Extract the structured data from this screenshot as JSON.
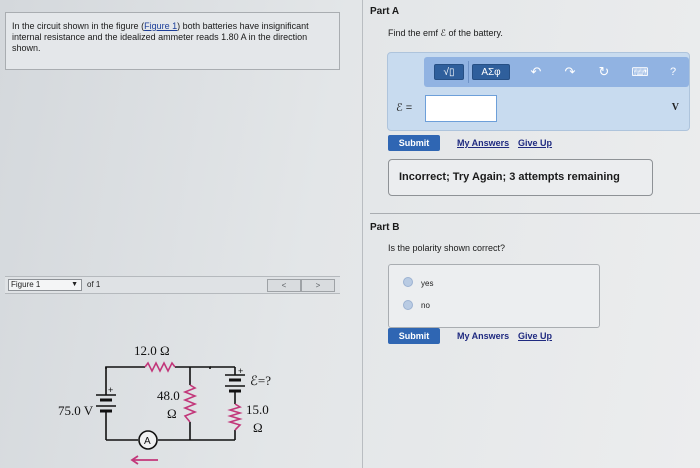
{
  "problem": {
    "text_pre": "In the circuit shown in the figure (",
    "figure_link": "Figure 1",
    "text_post": ") both batteries have insignificant internal resistance and the idealized ammeter reads 1.80 A in the direction shown."
  },
  "figure_nav": {
    "selected": "Figure 1",
    "of_text": "of 1",
    "prev": "<",
    "next": ">"
  },
  "circuit": {
    "top_resistor": "12.0 Ω",
    "left_battery": "75.0 V",
    "middle_resistor_value": "48.0",
    "middle_resistor_unit": "Ω",
    "right_battery": "ℰ=?",
    "right_resistor_value": "15.0",
    "right_resistor_unit": "Ω",
    "ammeter": "A",
    "plus": "+"
  },
  "partA": {
    "label": "Part A",
    "prompt": "Find the emf ℰ of the battery.",
    "toolbar": {
      "sqrt": "√▯",
      "greek": "ΑΣφ",
      "undo": "↶",
      "redo": "↷",
      "reset": "↻",
      "keyboard": "⌨",
      "help": "?"
    },
    "input_label": "ℰ =",
    "input_value": "",
    "unit": "V",
    "submit": "Submit",
    "my_answers": "My Answers",
    "give_up": "Give Up",
    "feedback": "Incorrect; Try Again; 3 attempts remaining"
  },
  "partB": {
    "label": "Part B",
    "prompt": "Is the polarity shown correct?",
    "options": [
      "yes",
      "no"
    ],
    "submit": "Submit",
    "my_answers": "My Answers",
    "give_up": "Give Up"
  }
}
